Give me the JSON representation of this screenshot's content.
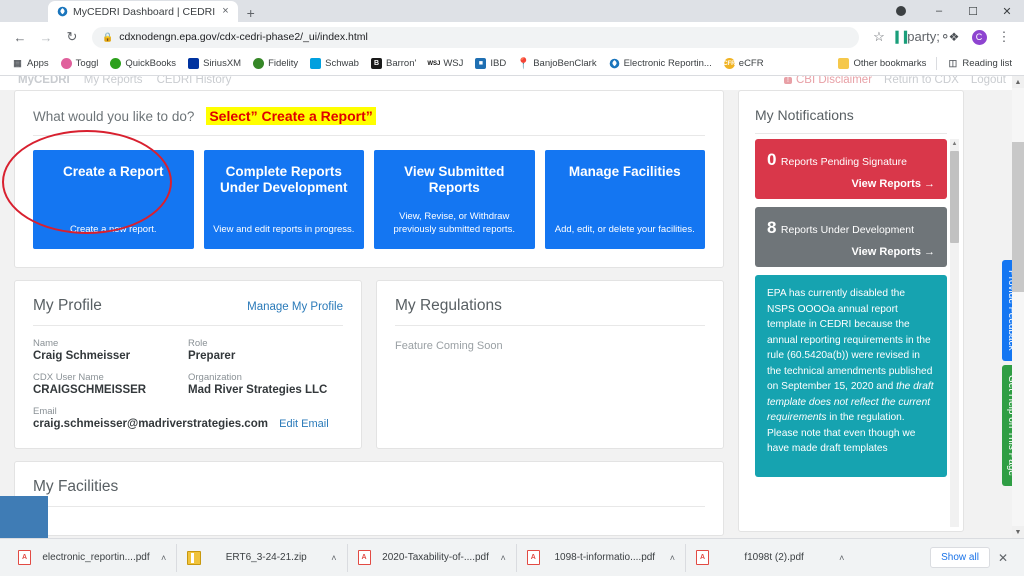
{
  "browser": {
    "tab": {
      "title": "MyCEDRI Dashboard | CEDRI",
      "close": "×",
      "favicon": "epa-logo-icon"
    },
    "newtab_label": "+",
    "window_controls": {
      "minimize": "–",
      "maximize": "☐",
      "close": "✕"
    },
    "nav": {
      "back": "←",
      "forward": "→",
      "reload": "↻"
    },
    "url": "cdxnodengn.epa.gov/cdx-cedri-phase2/_ui/index.html",
    "lock": "🔒",
    "toolbar_right": {
      "star": "☆",
      "extension_bars": "▐▐",
      "history": "◔",
      "puzzle": "✦",
      "avatar": "C",
      "menu": "⋮"
    },
    "bookmarks": [
      {
        "label": "Apps",
        "icon": "apps-grid-icon",
        "color": "#ffffff"
      },
      {
        "label": "Toggl",
        "icon": "toggl-icon",
        "color": "#e0609c"
      },
      {
        "label": "QuickBooks",
        "icon": "quickbooks-icon",
        "color": "#2ca01c"
      },
      {
        "label": "SiriusXM",
        "icon": "siriusxm-icon",
        "color": "#0033a0"
      },
      {
        "label": "Fidelity",
        "icon": "fidelity-icon",
        "color": "#368727"
      },
      {
        "label": "Schwab",
        "icon": "schwab-icon",
        "color": "#00a0df"
      },
      {
        "label": "Barron'",
        "icon": "barrons-icon",
        "color": "#1a1a1a"
      },
      {
        "label": "WSJ",
        "icon": "wsj-icon",
        "color": "#ffffff"
      },
      {
        "label": "IBD",
        "icon": "ibd-icon",
        "color": "#1f6fb2"
      },
      {
        "label": "BanjoBenClark",
        "icon": "location-pin-icon",
        "color": "#e02020"
      },
      {
        "label": "Electronic Reportin...",
        "icon": "epa-logo-icon",
        "color": "#ffffff"
      },
      {
        "label": "eCFR",
        "icon": "ecfr-icon",
        "color": "#f0b323"
      }
    ],
    "bookmarks_right": [
      {
        "label": "Other bookmarks",
        "icon": "folder-icon"
      },
      {
        "label": "Reading list",
        "icon": "reading-list-icon"
      }
    ]
  },
  "site_nav": {
    "brand": "MyCEDRI",
    "links": [
      "My Reports",
      "CEDRI History"
    ],
    "right_links": [
      "Return to CDX",
      "Logout"
    ],
    "cbi_disclaimer": "CBI Disclaimer",
    "cbi_badge": "!"
  },
  "actions_card": {
    "title": "What would you like to do?",
    "annotation": "Select” Create a Report”",
    "buttons": [
      {
        "title": "Create a Report",
        "desc": "Create a new report."
      },
      {
        "title": "Complete Reports Under Development",
        "desc": "View and edit reports in progress."
      },
      {
        "title": "View Submitted Reports",
        "desc": "View, Revise, or Withdraw previously submitted reports."
      },
      {
        "title": "Manage Facilities",
        "desc": "Add, edit, or delete your facilities."
      }
    ]
  },
  "profile": {
    "title": "My Profile",
    "manage_link": "Manage My Profile",
    "fields": [
      {
        "label": "Name",
        "value": "Craig Schmeisser"
      },
      {
        "label": "Role",
        "value": "Preparer"
      },
      {
        "label": "CDX User Name",
        "value": "CRAIGSCHMEISSER"
      },
      {
        "label": "Organization",
        "value": "Mad River Strategies LLC"
      }
    ],
    "email_label": "Email",
    "email_value": "craig.schmeisser@madriverstrategies.com",
    "edit_email_link": "Edit Email"
  },
  "regulations": {
    "title": "My Regulations",
    "body": "Feature Coming Soon"
  },
  "facilities": {
    "title": "My Facilities"
  },
  "notifications": {
    "title": "My Notifications",
    "items": [
      {
        "count": "0",
        "text": "Reports Pending Signature",
        "link": "View Reports →",
        "color": "#d9374a"
      },
      {
        "count": "8",
        "text": "Reports Under Development",
        "link": "View Reports →",
        "color": "#6f7579"
      }
    ],
    "announcement_color": "#16a3b0",
    "announcement_part1": "EPA has currently disabled the NSPS OOOOa annual report template in CEDRI because the annual reporting requirements in the rule (60.5420a(b)) were revised in the technical amendments published on September 15, 2020 and ",
    "announcement_italic": "the draft template does not reflect the current requirements",
    "announcement_part2": " in the regulation. Please note that even though we have made draft templates"
  },
  "side_tabs": [
    {
      "label": "Provide Feedback",
      "color": "#1476f2"
    },
    {
      "label": "Get Help on This Page",
      "color": "#2f9e44"
    }
  ],
  "downloads": {
    "items": [
      {
        "name": "electronic_reportin....pdf",
        "type": "pdf"
      },
      {
        "name": "ERT6_3-24-21.zip",
        "type": "zip"
      },
      {
        "name": "2020-Taxability-of-....pdf",
        "type": "pdf"
      },
      {
        "name": "1098-t-informatio....pdf",
        "type": "pdf"
      },
      {
        "name": "f1098t (2).pdf",
        "type": "pdf"
      }
    ],
    "caret": "˄",
    "show_all": "Show all",
    "close": "✕"
  }
}
